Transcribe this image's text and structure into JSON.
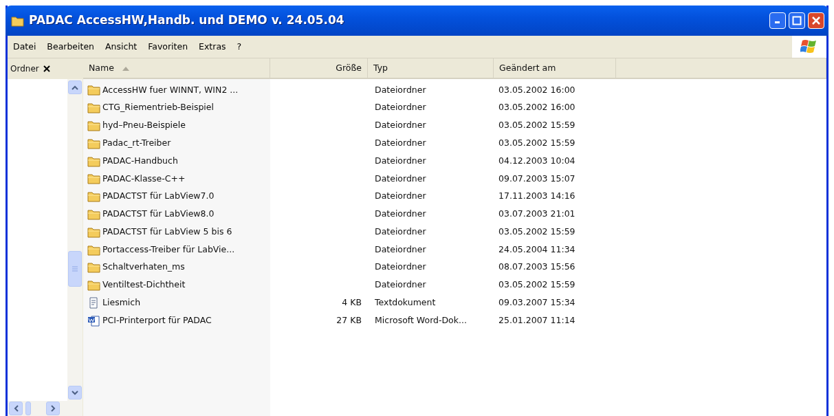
{
  "window": {
    "title": "PADAC AccessHW,Handb. und DEMO v. 24.05.04"
  },
  "menu": [
    "Datei",
    "Bearbeiten",
    "Ansicht",
    "Favoriten",
    "Extras",
    "?"
  ],
  "folder_pane": {
    "title": "Ordner"
  },
  "table": {
    "columns": [
      {
        "label": "Name",
        "sorted": true
      },
      {
        "label": "Größe",
        "sorted": false
      },
      {
        "label": "Typ",
        "sorted": false
      },
      {
        "label": "Geändert am",
        "sorted": false
      }
    ],
    "rows": [
      {
        "kind": "folder",
        "name": "AccessHW fuer WINNT, WIN2 ...",
        "type": "Dateiordner",
        "modified": "03.05.2002 16:00"
      },
      {
        "kind": "folder",
        "name": "CTG_Riementrieb-Beispiel",
        "type": "Dateiordner",
        "modified": "03.05.2002 16:00"
      },
      {
        "kind": "folder",
        "name": "hyd–Pneu-Beispiele",
        "type": "Dateiordner",
        "modified": "03.05.2002 15:59"
      },
      {
        "kind": "folder",
        "name": "Padac_rt-Treiber",
        "type": "Dateiordner",
        "modified": "03.05.2002 15:59"
      },
      {
        "kind": "folder",
        "name": "PADAC-Handbuch",
        "type": "Dateiordner",
        "modified": "04.12.2003 10:04"
      },
      {
        "kind": "folder",
        "name": "PADAC-Klasse-C++",
        "type": "Dateiordner",
        "modified": "09.07.2003 15:07"
      },
      {
        "kind": "folder",
        "name": "PADACTST für LabView7.0",
        "type": "Dateiordner",
        "modified": "17.11.2003 14:16"
      },
      {
        "kind": "folder",
        "name": "PADACTST für LabView8.0",
        "type": "Dateiordner",
        "modified": "03.07.2003 21:01"
      },
      {
        "kind": "folder",
        "name": "PADACTST für LabView 5 bis 6",
        "type": "Dateiordner",
        "modified": "03.05.2002 15:59"
      },
      {
        "kind": "folder",
        "name": "Portaccess-Treiber für LabVie...",
        "type": "Dateiordner",
        "modified": "24.05.2004 11:34"
      },
      {
        "kind": "folder",
        "name": "Schaltverhaten_ms",
        "type": "Dateiordner",
        "modified": "08.07.2003 15:56"
      },
      {
        "kind": "folder",
        "name": "Ventiltest-Dichtheit",
        "type": "Dateiordner",
        "modified": "03.05.2002 15:59"
      },
      {
        "kind": "text",
        "name": "Liesmich",
        "size": "4 KB",
        "type": "Textdokument",
        "modified": "09.03.2007 15:34"
      },
      {
        "kind": "word",
        "name": "PCI-Printerport für PADAC",
        "size": "27 KB",
        "type": "Microsoft Word-Dok...",
        "modified": "25.01.2007 11:14"
      }
    ]
  }
}
